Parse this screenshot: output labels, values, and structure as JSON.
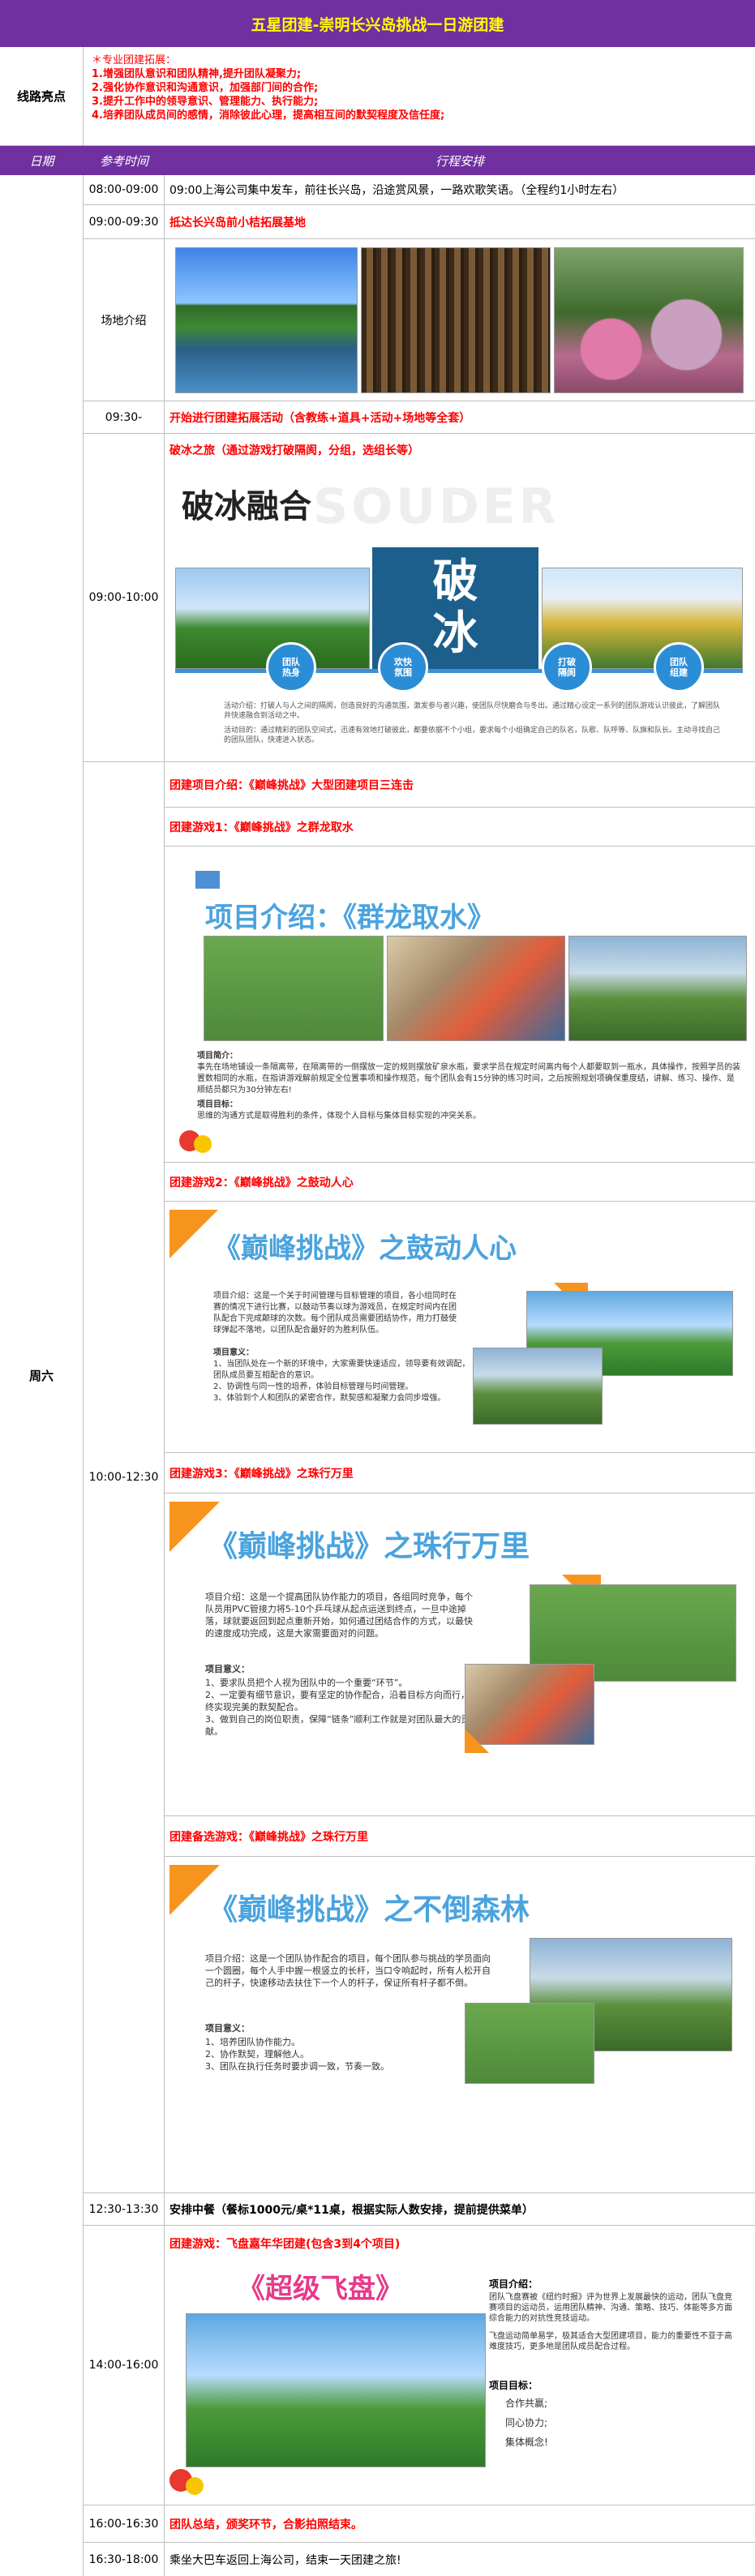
{
  "title": "五星团建-崇明长兴岛挑战一日游团建",
  "highlights": {
    "label": "线路亮点",
    "heading": "＊专业团建拓展：",
    "items": [
      "1.增强团队意识和团队精神,提升团队凝聚力;",
      "2.强化协作意识和沟通意识，加强部门间的合作;",
      "3.提升工作中的领导意识、管理能力、执行能力;",
      "4.培养团队成员间的感情，消除彼此心理，提高相互间的默契程度及信任度;"
    ]
  },
  "header": {
    "date": "日期",
    "time": "参考时间",
    "schedule": "行程安排"
  },
  "day": "周六",
  "rows": {
    "r1": {
      "time": "08:00-09:00",
      "text": "09:00上海公司集中发车，前往长兴岛，沿途赏风景，一路欢歌笑语。（全程约1小时左右）"
    },
    "r2": {
      "time": "09:00-09:30",
      "text": "抵达长兴岛前小桔拓展基地"
    },
    "r3": {
      "time": "场地介绍"
    },
    "r4": {
      "time": "09:30-",
      "text": "开始进行团建拓展活动（含教练+道具+活动+场地等全套）"
    },
    "r5": {
      "time": "09:00-10:00",
      "text": "破冰之旅（通过游戏打破隔阂，分组，选组长等）"
    },
    "r6": {
      "time": "10:00-12:30"
    },
    "r7": {
      "time": "12:30-13:30",
      "text": "安排中餐（餐标1000元/桌*11桌，根据实际人数安排，提前提供菜单）"
    },
    "r8": {
      "time": "14:00-16:00",
      "text": "团建游戏：飞盘嘉年华团建(包含3到4个项目)"
    },
    "r9": {
      "time": "16:00-16:30",
      "text": "团队总结，颁奖环节，合影拍照结束。"
    },
    "r10": {
      "time": "16:30-18:00",
      "text": "乘坐大巴车返回上海公司，结束一天团建之旅!"
    }
  },
  "icebreak": {
    "title": "破冰融合",
    "watermark": "SOUDER",
    "bingo": [
      "破",
      "冰"
    ],
    "badges": [
      "团队\n热身",
      "欢快\n氛围",
      "打破\n隔阂",
      "团队\n组建"
    ],
    "caption1": "活动介绍：打破人与人之间的隔阂，创造良好的沟通氛围，激发参与者兴趣，使团队尽快磨合与冬出。通过精心设定一系列的团队游戏认识彼此，了解团队并快速融合到活动之中。",
    "caption2": "活动目的：通过精彩的团队空间式，迅速有效地打破彼此，都要依据不个小组，要求每个小组确定自己的队名，队歌、队呼等、队旗和队长。主动寻找自己的团队团队，快速进入状态。"
  },
  "project": {
    "header": "团建项目介绍：《巅峰挑战》大型团建项目三连击",
    "g1_header": "团建游戏1：《巅峰挑战》之群龙取水",
    "g1_title": "项目介绍：《群龙取水》",
    "g1_intro_label": "项目简介：",
    "g1_intro": "事先在场地铺设一条隔离带，在隔离带的一侧摆放一定的规则摆放矿泉水瓶，要求学员在规定时间离内每个人都要取到一瓶水，具体操作，按照学员的装置数相同的水瓶，在指讲游戏解前规定全位置事项和操作规范，每个团队会有15分钟的练习时间，之后按照规划项确保重度结，讲解、练习、操作、是顺结员都只为30分钟左右!",
    "g1_goal_label": "项目目标：",
    "g1_goal": "思维的沟通方式是取得胜利的条件，体现个人目标与集体目标实现的冲突关系。",
    "g2_header": "团建游戏2：《巅峰挑战》之鼓动人心",
    "g2_title": "《巅峰挑战》之鼓动人心",
    "g2_text1": "项目介绍：这是一个关于时间管理与目标管理的项目，各小组同时在赛的情况下进行比赛，以鼓动节奏以球为游戏员，在规定时间内在团队配合下完成颠球的次数。每个团队成员需要团结协作，用力打鼓使球弹起不落地，以团队配合最好的为胜利队伍。",
    "g2_meaning_label": "项目意义：",
    "g2_meaning": "1、当团队处在一个新的环境中，大家需要快速适应，领导要有效调配，团队成员要互相配合的意识。\n2、协调性与同一性的培养，体验目标管理与时间管理。\n3、体验到个人和团队的紧密合作，默契感和凝聚力会同步增强。",
    "g3_header": "团建游戏3：《巅峰挑战》之珠行万里",
    "g3_title": "《巅峰挑战》之珠行万里",
    "g3_text1": "项目介绍：这是一个提高团队协作能力的项目，各组同时竞争，每个队员用PVC管接力将5-10个乒乓球从起点运送到终点，一旦中途掉落，球就要返回到起点重新开始，如何通过团结合作的方式，以最快的速度成功完成，这是大家需要面对的问题。",
    "g3_meaning_label": "项目意义：",
    "g3_meaning": "1、要求队员把个人视为团队中的一个重要“环节”。\n2、一定要有细节意识，要有坚定的协作配合，沿着目标方向而行，最终实现完美的默契配合。\n3、做到自己的岗位职责，保障“链条”顺利工作就是对团队最大的贡献。",
    "g4_header": "团建备选游戏：《巅峰挑战》之珠行万里",
    "g4_title": "《巅峰挑战》之不倒森林",
    "g4_text1": "项目介绍：这是一个团队协作配合的项目，每个团队参与挑战的学员面向一个圆圈，每个人手中握一根竖立的长杆，当口令响起时，所有人松开自己的杆子，快速移动去扶住下一个人的杆子，保证所有杆子都不倒。",
    "g4_meaning_label": "项目意义：",
    "g4_meaning": "1、培养团队协作能力。\n2、协作默契，理解他人。\n3、团队在执行任务时要步调一致，节奏一致。"
  },
  "frisbee": {
    "title": "《超级飞盘》",
    "intro_label": "项目介绍：",
    "intro": "团队飞盘赛被《纽约时报》评为世界上发展最快的运动，团队飞盘竞赛项目的运动员，运用团队精神、沟通、策略、技巧、体能等多方面综合能力的对抗性竞技运动。",
    "intro2": "飞盘运动简单易学，极其适合大型团建项目，能力的重要性不亚于高难度技巧，更多地是团队成员配合过程。",
    "goal_label": "项目目标：",
    "goals": [
      "合作共赢;",
      "同心协力;",
      "集体概念!"
    ]
  }
}
